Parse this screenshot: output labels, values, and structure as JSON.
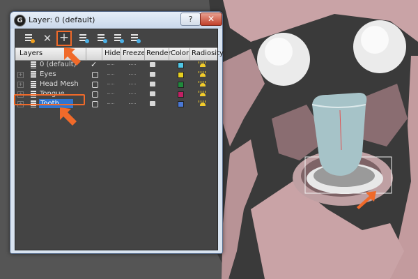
{
  "window": {
    "title": "Layer: 0 (default)",
    "help_label": "?",
    "close_label": "✕",
    "app_icon": "3ds-max-icon"
  },
  "toolbar": {
    "buttons": [
      {
        "name": "create-layer-icon"
      },
      {
        "name": "delete-layer-icon",
        "label": "✕"
      },
      {
        "name": "add-to-layer-icon",
        "label": "+"
      },
      {
        "name": "select-objects-icon"
      },
      {
        "name": "highlight-selected-icon"
      },
      {
        "name": "hide-unhide-icon"
      },
      {
        "name": "freeze-unfreeze-icon"
      }
    ]
  },
  "columns": [
    "Layers",
    "Hide",
    "Freeze",
    "Render",
    "Color",
    "Radiosity"
  ],
  "layers": [
    {
      "name": "0 (default)",
      "current": true,
      "color": "#4ec6e6",
      "selected": false
    },
    {
      "name": "Eyes",
      "current": false,
      "color": "#e6cf1f",
      "selected": false
    },
    {
      "name": "Head Mesh",
      "current": false,
      "color": "#1f8a3c",
      "selected": false
    },
    {
      "name": "Tongue",
      "current": false,
      "color": "#c21f63",
      "selected": false
    },
    {
      "name": "Tooth",
      "current": false,
      "color": "#4a78d6",
      "selected": true
    }
  ],
  "colors": {
    "highlight": "#f06a2a",
    "selection": "#2e74d0",
    "panel": "#444444"
  }
}
